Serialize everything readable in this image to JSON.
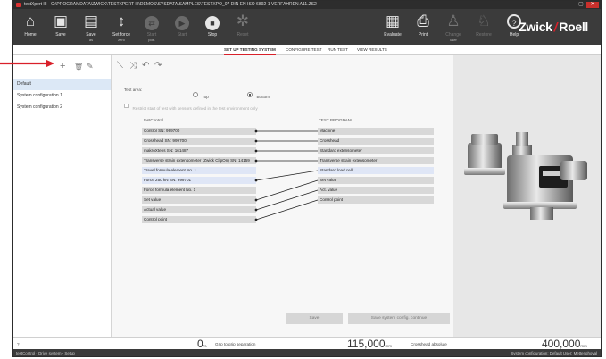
{
  "window": {
    "title": "testXpert III - C:\\PROGRAMDATA\\ZWICK\\TESTXPERT III\\DEMOS\\SYSDATA\\SAMPLES\\TESTXPO_07 DIN EN ISO 6892-1 VERFAHREN A11.ZS2",
    "controls": [
      "–",
      "▢",
      "✕"
    ]
  },
  "toolbar": {
    "buttons": [
      {
        "label": "Home",
        "icon": "home-icon",
        "glyph": "⌂"
      },
      {
        "label": "Save",
        "icon": "save-icon",
        "glyph": "▣"
      },
      {
        "label": "Save",
        "sub": "as",
        "icon": "save-as-icon",
        "glyph": "▤"
      },
      {
        "label": "Set force",
        "sub": "zero",
        "icon": "set-force-zero-icon",
        "glyph": "↕"
      },
      {
        "label": "Start",
        "sub": "pos.",
        "icon": "start-position-icon",
        "glyph": "⇄"
      },
      {
        "label": "Start",
        "icon": "start-icon",
        "glyph": "▶"
      },
      {
        "label": "Stop",
        "icon": "stop-icon",
        "glyph": "■"
      },
      {
        "label": "Reset",
        "icon": "reset-icon",
        "glyph": "✲"
      },
      {
        "label": "Evaluate",
        "icon": "evaluate-icon",
        "glyph": "▦"
      },
      {
        "label": "Print",
        "icon": "print-icon",
        "glyph": "⎙"
      },
      {
        "label": "Change",
        "sub": "user",
        "icon": "change-user-icon",
        "glyph": "♙"
      },
      {
        "label": "Restore",
        "icon": "restore-icon",
        "glyph": "♘"
      },
      {
        "label": "Help",
        "icon": "help-icon",
        "glyph": "?"
      }
    ],
    "brand_left": "Zwick",
    "brand_right": "Roell"
  },
  "tabs": [
    {
      "label": "SET UP TESTING SYSTEM",
      "active": true
    },
    {
      "label": "CONFIGURE TEST",
      "active": false
    },
    {
      "label": "RUN TEST",
      "active": false
    },
    {
      "label": "VIEW RESULTS",
      "active": false
    }
  ],
  "left_panel": {
    "tools": {
      "add": "+",
      "delete": "🗑",
      "edit": "✎"
    },
    "configurations": [
      "Default",
      "System configuration 1",
      "System configuration 2"
    ],
    "selected_index": 0
  },
  "center": {
    "tools": [
      "⟍",
      "⤨",
      "↶",
      "↷"
    ],
    "test_area_label": "Test area:",
    "test_area_options": [
      "Top",
      "Bottom"
    ],
    "test_area_selected": "Bottom",
    "restrict_label": "Restrict start of test with sensors defined in the test environment only",
    "testcontrol_header": "testControl",
    "program_header": "TEST PROGRAM",
    "testcontrol_items": [
      "Control SN: 999700",
      "Crosshead SN: 999700",
      "makroXtens SN: 161487",
      "Transverse strain extensometer (Zwick ClipOn) SN: 14159",
      "Travel formula element No. 1",
      "Force 250 kN SN: 999701",
      "Force formula element No. 1",
      "Set value",
      "Actual value",
      "Control point"
    ],
    "program_items": [
      "Machine",
      "Crosshead",
      "Standard extensometer",
      "Transverse strain extensometer",
      "Standard load cell",
      "Set value",
      "Act. value",
      "Control point"
    ],
    "save_label": "Save",
    "save_continue_label": "Save system config. continue"
  },
  "status": {
    "left_char": "?",
    "grip_value": "0",
    "grip_unit": "%",
    "grip_label": "Grip to grip separation",
    "crosshead_value": "115,000",
    "crosshead_unit": "mm",
    "crosshead_label": "Crosshead absolute",
    "force_value": "400,000",
    "force_unit": "mm"
  },
  "bottom": {
    "left": "testControl - Drive system - Setup",
    "right": "System configuration: Default    User: Mettenghoval"
  },
  "colors": {
    "accent": "#d9202a",
    "toolbar": "#3b3b3b",
    "selection": "#dce8f6"
  }
}
